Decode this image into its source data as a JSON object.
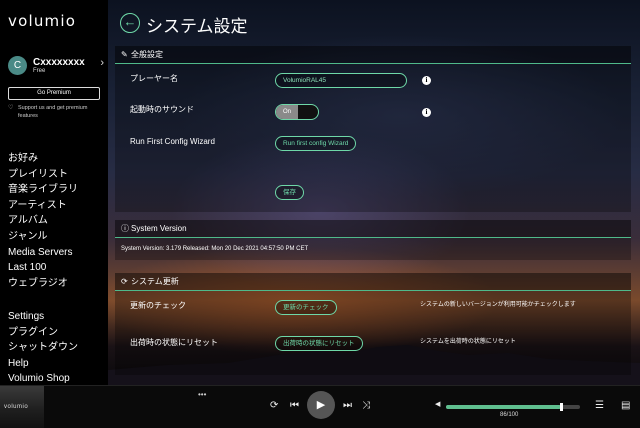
{
  "app": {
    "logo": "volumio"
  },
  "user": {
    "initial": "C",
    "name": "Cxxxxxxxx",
    "plan": "Free"
  },
  "sidebar": {
    "premium_button": "Go Premium",
    "support_text": "Support us and get premium features",
    "nav_primary": [
      "お好み",
      "プレイリスト",
      "音楽ライブラリ",
      "アーティスト",
      "アルバム",
      "ジャンル",
      "Media Servers",
      "Last 100",
      "ウェブラジオ"
    ],
    "nav_secondary": [
      "Settings",
      "プラグイン",
      "シャットダウン",
      "Help",
      "Volumio Shop"
    ]
  },
  "page": {
    "title": "システム設定"
  },
  "general": {
    "header": "全般設定",
    "player_name_label": "プレーヤー名",
    "player_name_value": "VolumioRAL45",
    "startup_sound_label": "起動時のサウンド",
    "startup_sound_state": "On",
    "wizard_label": "Run First Config Wizard",
    "wizard_button": "Run first config Wizard",
    "save_button": "保存"
  },
  "system_version": {
    "header": "System Version",
    "text": "System Version: 3.179 Released: Mon 20 Dec 2021 04:57:50 PM CET"
  },
  "system_update": {
    "header": "システム更新",
    "check_label": "更新のチェック",
    "check_button": "更新のチェック",
    "check_desc": "システムの新しいバージョンが利用可能かチェックします",
    "reset_label": "出荷時の状態にリセット",
    "reset_button": "出荷時の状態にリセット",
    "reset_desc": "システムを出荷時の状態にリセット"
  },
  "player": {
    "thumb_logo": "volumio",
    "menu_dots": "•••",
    "volume_text": "86/100",
    "volume_level": 0.86
  },
  "colors": {
    "accent": "#6ed8a8",
    "volume": "#5fbf8f"
  }
}
